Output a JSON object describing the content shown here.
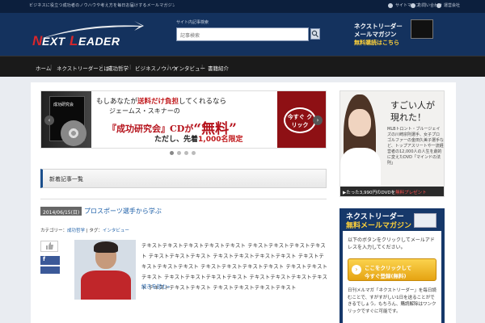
{
  "topbar": {
    "tagline": "ビジネスに役立つ成功者のノウハウや考え方を毎日お届けするメールマガジン「ネクストリーダー」公式サイト",
    "links": [
      "サイトマップ",
      "お問い合わせ",
      "運営会社"
    ]
  },
  "header": {
    "logo_text": "NEXTLEADER",
    "search_label": "サイト内記事検索",
    "search_placeholder": "記事検索",
    "mm_banner": {
      "line1": "ネクストリーダー",
      "line2": "メールマガジン",
      "line3": "無料購読はこちら"
    }
  },
  "nav": {
    "items": [
      "ホーム",
      "ネクストリーダーとは？",
      "成功哲学",
      "ビジネスノウハウ",
      "インタビュー",
      "書籍紹介"
    ]
  },
  "slider": {
    "line1_a": "もしあなたが",
    "line1_b": "送料だけ負担",
    "line1_c": "してくれるなら",
    "line2": "ジェームス・スキナーの",
    "line3_a": "『成功研究会』CDが",
    "line3_b": "“無料”",
    "line4_a": "ただし、先着",
    "line4_b": "1,000名限定",
    "book_label": "成功研究会",
    "cta": "今すぐ クリック",
    "dots": 4
  },
  "section": {
    "title": "新着記事一覧"
  },
  "post": {
    "date": "2014/06/15(日)",
    "title": "プロスポーツ選手から学ぶ",
    "meta_prefix": "カテゴリー：",
    "meta_cat": "成功哲学",
    "meta_sep": " | タグ：",
    "meta_tag": "インタビュー",
    "like_count": "0",
    "fb_label": "f",
    "excerpt": "テキストテキストテキストテキストテキスト テキストテキストテキストテキスト テキストテキストテキスト テキストテキストテキストテキスト テキストテキストテキストテキスト テキストテキストテキストテキスト テキストテキストテキスト テキストテキストテキストテキスト テキストテキストテキストテキスト テキストテキストテキスト テキストテキストテキストテキスト",
    "more": "続きを読む»"
  },
  "ad": {
    "headline": "すごい人が 現れた！",
    "body": "MLBトロント・ブルージェイズの川崎宗則選手、女子プロゴルファーの金田久美子選手など、トップアスリートや一流経営者の12,000人の人生を劇的に変えたDVD「マインドの法則」",
    "bar_a": "▶たった3,990円のDVDを",
    "bar_b": "無料プレゼント"
  },
  "mailmag": {
    "title1": "ネクストリーダー",
    "title2": "無料メールマガジン",
    "desc": "以下のボタンをクリックしてメールアドレスを入力してください。",
    "cta1": "ここをクリックして",
    "cta2": "今すぐ登録(無料)",
    "note": "日刊メルマガ「ネクストリーダー」を毎日読むことで、すがすがしい1日を送ることができるでしょう。もちろん、購読解除はワンクリックですぐに可能です。"
  },
  "colors": {
    "topbar": "#0c1f3d",
    "header": "#14325e",
    "nav": "#1a1a1a",
    "accent_red": "#c0181b",
    "link_blue": "#1d5fa8",
    "cta_yellow": "#fbd34d"
  }
}
